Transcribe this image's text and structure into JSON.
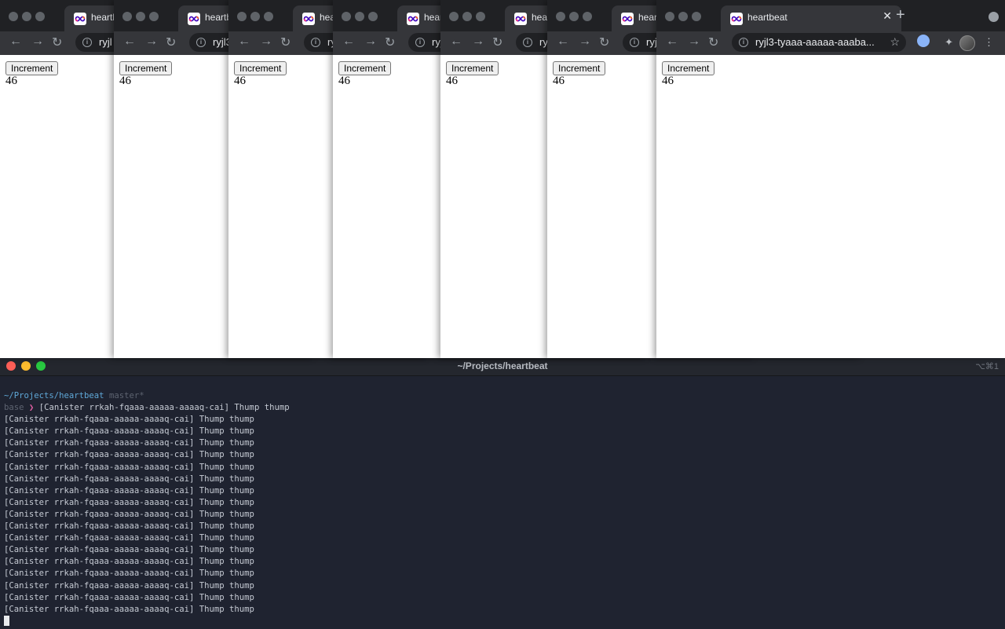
{
  "browser": {
    "tab_title": "heartbeat",
    "tab_close_glyph": "✕",
    "new_tab_glyph": "+",
    "url_partials": [
      "ryjl",
      "ryjl3",
      "ryjl3",
      "ryjl3",
      "ryjl3",
      "ryjl3"
    ],
    "url_full": "ryjl3-tyaaa-aaaaa-aaaba...",
    "star_glyph": "☆",
    "puzzle_glyph": "✦",
    "button_label": "Increment",
    "count_value": "46",
    "nav_glyphs": {
      "back": "←",
      "forward": "→",
      "reload": "↻"
    },
    "favicon_icon": "infinity-logo-icon"
  },
  "terminal": {
    "title": "~/Projects/heartbeat",
    "shortcut": "⌥⌘1",
    "prompt_cwd": "~/Projects/heartbeat",
    "prompt_branch": "master*",
    "prompt_env": "base",
    "prompt_arrow": "❯",
    "first_line_output": "[Canister rrkah-fqaaa-aaaaa-aaaaq-cai] Thump thump",
    "log_lines": [
      "[Canister rrkah-fqaaa-aaaaa-aaaaq-cai] Thump thump",
      "[Canister rrkah-fqaaa-aaaaa-aaaaq-cai] Thump thump",
      "[Canister rrkah-fqaaa-aaaaa-aaaaq-cai] Thump thump",
      "[Canister rrkah-fqaaa-aaaaa-aaaaq-cai] Thump thump",
      "[Canister rrkah-fqaaa-aaaaa-aaaaq-cai] Thump thump",
      "[Canister rrkah-fqaaa-aaaaa-aaaaq-cai] Thump thump",
      "[Canister rrkah-fqaaa-aaaaa-aaaaq-cai] Thump thump",
      "[Canister rrkah-fqaaa-aaaaa-aaaaq-cai] Thump thump",
      "[Canister rrkah-fqaaa-aaaaa-aaaaq-cai] Thump thump",
      "[Canister rrkah-fqaaa-aaaaa-aaaaq-cai] Thump thump",
      "[Canister rrkah-fqaaa-aaaaa-aaaaq-cai] Thump thump",
      "[Canister rrkah-fqaaa-aaaaa-aaaaq-cai] Thump thump",
      "[Canister rrkah-fqaaa-aaaaa-aaaaq-cai] Thump thump",
      "[Canister rrkah-fqaaa-aaaaa-aaaaq-cai] Thump thump",
      "[Canister rrkah-fqaaa-aaaaa-aaaaq-cai] Thump thump",
      "[Canister rrkah-fqaaa-aaaaa-aaaaq-cai] Thump thump",
      "[Canister rrkah-fqaaa-aaaaa-aaaaq-cai] Thump thump"
    ]
  },
  "colors": {
    "terminal_bg": "#1f2330",
    "chrome_dark": "#202124",
    "chrome_toolbar": "#35363a",
    "prompt_arrow": "#e15fa3",
    "cwd": "#5fa8d8"
  }
}
